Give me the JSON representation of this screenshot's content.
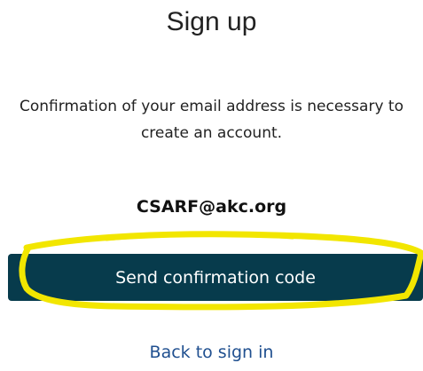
{
  "header": {
    "title": "Sign up"
  },
  "main": {
    "message_line1": "Confirmation of your email address is necessary to",
    "message_line2": "create an account.",
    "email": "CSARF@akc.org",
    "send_button_label": "Send confirmation code",
    "back_link_label": "Back to sign in"
  },
  "colors": {
    "button_background": "#073b4c",
    "highlight_yellow": "#f2e600",
    "link": "#1f4f8f"
  }
}
